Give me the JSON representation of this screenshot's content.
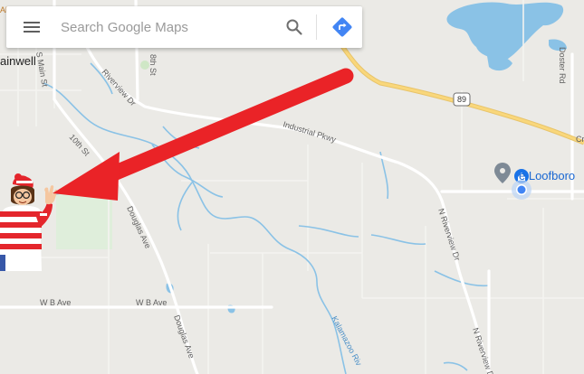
{
  "search": {
    "placeholder": "Search Google Maps"
  },
  "icons": {
    "menu": "hamburger-menu-icon",
    "search": "search-icon",
    "directions": "directions-icon",
    "place_pin": "place-pin-icon",
    "home": "home-icon",
    "location": "my-location-dot-icon",
    "arrow": "red-arrow-annotation",
    "character": "waldo-character-icon"
  },
  "colors": {
    "map_bg": "#ebeae6",
    "road": "#ffffff",
    "highway": "#f9d77b",
    "water": "#8ac2e6",
    "park": "#e0eedb",
    "arrow": "#ea2327",
    "directions": "#4285f4"
  },
  "map_labels": {
    "town": "ainwell",
    "highway_shield": "89",
    "riverview_dr": "Riverview Dr",
    "industrial_pkwy": "Industrial Pkwy",
    "tenth_st": "10th St",
    "douglas_ave_upper": "Douglas Ave",
    "douglas_ave_lower": "Douglas Ave",
    "n_riverview_dr_upper": "N Riverview Dr",
    "n_riverview_dr_lower": "N Riverview Dr",
    "wb_ave_left": "W B Ave",
    "wb_ave_right": "W B Ave",
    "main_st": "S Main St",
    "eighth_st": "8th St",
    "doster_rd": "Doster Rd",
    "kalamazoo": "Kalamazoo Riv",
    "poi": "e Loofboro",
    "cr_fragment": "Cr",
    "al_fragment": "Al"
  }
}
